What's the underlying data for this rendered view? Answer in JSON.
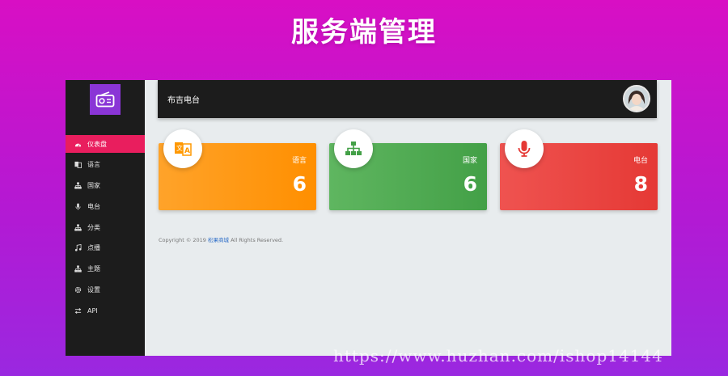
{
  "banner": {
    "title": "服务端管理"
  },
  "topbar": {
    "title": "布吉电台"
  },
  "sidebar": {
    "items": [
      {
        "label": "仪表盘",
        "icon": "dashboard-icon",
        "active": true
      },
      {
        "label": "语言",
        "icon": "language-icon"
      },
      {
        "label": "国家",
        "icon": "hierarchy-icon"
      },
      {
        "label": "电台",
        "icon": "microphone-icon"
      },
      {
        "label": "分类",
        "icon": "hierarchy-icon"
      },
      {
        "label": "点播",
        "icon": "music-note-icon"
      },
      {
        "label": "主题",
        "icon": "hierarchy-icon"
      },
      {
        "label": "设置",
        "icon": "gear-icon"
      },
      {
        "label": "API",
        "icon": "swap-arrows-icon"
      }
    ]
  },
  "cards": [
    {
      "label": "语言",
      "value": "6",
      "icon": "translate-icon",
      "color": "#ff9800"
    },
    {
      "label": "国家",
      "value": "6",
      "icon": "sitemap-icon",
      "color": "#4caf50"
    },
    {
      "label": "电台",
      "value": "8",
      "icon": "microphone-icon",
      "color": "#f44336"
    }
  ],
  "footer": {
    "prefix": "Copyright © 2019",
    "link": "松果商城",
    "suffix": "All Rights Reserved."
  },
  "fab": {
    "label": "+"
  },
  "watermark": "https://www.huzhan.com/ishop14144",
  "colors": {
    "accent": "#e91e5e",
    "sidebar": "#1c1c1c",
    "logo": "#8a35d6"
  }
}
